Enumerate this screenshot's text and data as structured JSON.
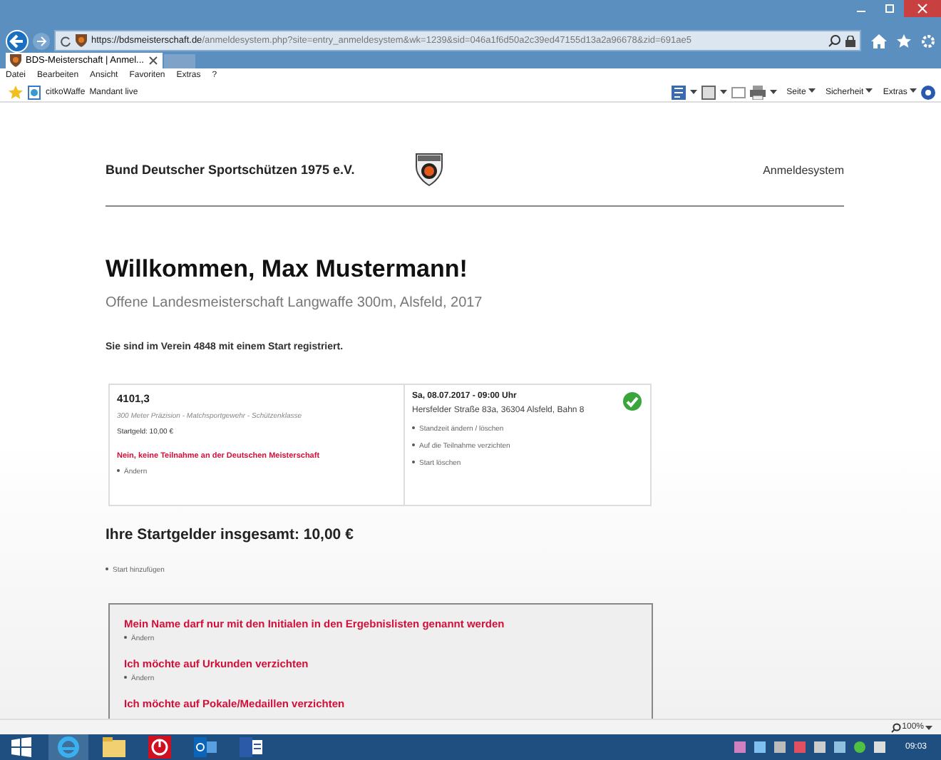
{
  "browser": {
    "url_host": "https://bdsmeisterschaft.de",
    "url_path": "/anmeldesystem.php?site=entry_anmeldesystem&wk=1239&sid=046a1f6d50a2c39ed47155d13a2a96678&zid=691ae5",
    "tabs": [
      {
        "label": "BDS-Meisterschaft | Anmel...",
        "selected": true
      }
    ],
    "menu": [
      "Datei",
      "Bearbeiten",
      "Ansicht",
      "Favoriten",
      "Extras",
      "?"
    ],
    "favorites": [
      "citkoWaffe",
      "Mandant live"
    ],
    "commands": [
      "Seite",
      "Sicherheit",
      "Extras"
    ],
    "zoom": "100%"
  },
  "page": {
    "org": "Bund Deutscher Sportschützen 1975 e.V.",
    "system": "Anmeldesystem",
    "heading": "Willkommen, Max Mustermann!",
    "subtitle": "Offene Landesmeisterschaft Langwaffe 300m, Alsfeld, 2017",
    "info": "Sie sind im Verein 4848 mit einem Start registriert.",
    "starts": [
      {
        "number": "4101,3",
        "discipline": "300 Meter Präzision - Matchsportgewehr - Schützenklasse",
        "fee": "Startgeld: 10,00 €",
        "notice": "Nein, keine Teilnahme an der Deutschen Meisterschaft",
        "notice_link": "Ändern",
        "date": "Sa, 08.07.2017 - 09:00 Uhr",
        "address": "Hersfelder Straße 83a, 36304 Alsfeld, Bahn 8",
        "confirmed": true,
        "links": [
          "Standzeit ändern / löschen",
          "Auf die Teilnahme verzichten",
          "Start löschen"
        ]
      }
    ],
    "total": "Ihre Startgelder insgesamt: 10,00 €",
    "add_link": "Start hinzufügen",
    "options": [
      {
        "text": "Mein Name darf nur mit den Initialen in den Ergebnislisten genannt werden",
        "link": "Ändern"
      },
      {
        "text": "Ich möchte auf Urkunden verzichten",
        "link": "Ändern"
      },
      {
        "text": "Ich möchte auf Pokale/Medaillen verzichten"
      }
    ]
  },
  "taskbar": {
    "time": "09:03"
  }
}
